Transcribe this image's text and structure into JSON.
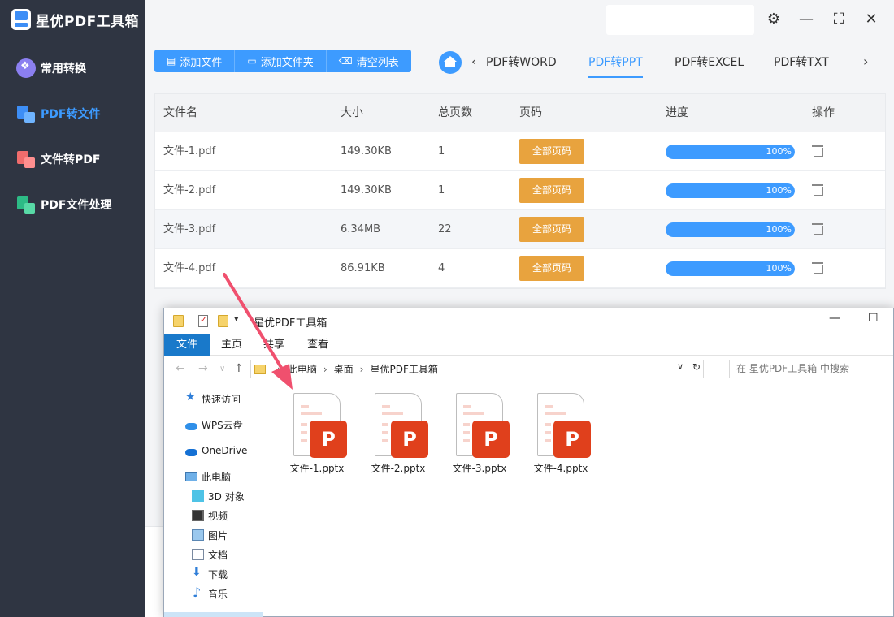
{
  "app": {
    "title": "星优PDF工具箱"
  },
  "sidebar": {
    "items": [
      {
        "label": "常用转换",
        "icon": "apps-icon",
        "active": false
      },
      {
        "label": "PDF转文件",
        "icon": "pdf-to-file-icon",
        "active": true
      },
      {
        "label": "文件转PDF",
        "icon": "file-to-pdf-icon",
        "active": false
      },
      {
        "label": "PDF文件处理",
        "icon": "pdf-process-icon",
        "active": false
      }
    ]
  },
  "window_controls": {
    "settings": "⚙",
    "minimize": "—",
    "maximize": "⛶",
    "close": "✕"
  },
  "toolbar": {
    "add_file": "添加文件",
    "add_folder": "添加文件夹",
    "clear_list": "清空列表"
  },
  "tabs": {
    "items": [
      "PDF转WORD",
      "PDF转PPT",
      "PDF转EXCEL",
      "PDF转TXT"
    ],
    "active_index": 1
  },
  "table": {
    "headers": {
      "name": "文件名",
      "size": "大小",
      "pages": "总页数",
      "range": "页码",
      "progress": "进度",
      "action": "操作"
    },
    "rows": [
      {
        "name": "文件-1.pdf",
        "size": "149.30KB",
        "pages": "1",
        "range": "全部页码",
        "progress": 100,
        "progress_label": "100%"
      },
      {
        "name": "文件-2.pdf",
        "size": "149.30KB",
        "pages": "1",
        "range": "全部页码",
        "progress": 100,
        "progress_label": "100%"
      },
      {
        "name": "文件-3.pdf",
        "size": "6.34MB",
        "pages": "22",
        "range": "全部页码",
        "progress": 100,
        "progress_label": "100%"
      },
      {
        "name": "文件-4.pdf",
        "size": "86.91KB",
        "pages": "4",
        "range": "全部页码",
        "progress": 100,
        "progress_label": "100%"
      }
    ]
  },
  "explorer": {
    "title": "星优PDF工具箱",
    "ribbon_tabs": [
      "文件",
      "主页",
      "共享",
      "查看"
    ],
    "breadcrumb": [
      "此电脑",
      "桌面",
      "星优PDF工具箱"
    ],
    "search_placeholder": "在 星优PDF工具箱 中搜索",
    "nav_items": [
      "快速访问",
      "WPS云盘",
      "OneDrive",
      "此电脑",
      "3D 对象",
      "视频",
      "图片",
      "文档",
      "下载",
      "音乐"
    ],
    "files": [
      {
        "name": "文件-1.pptx",
        "badge": "P"
      },
      {
        "name": "文件-2.pptx",
        "badge": "P"
      },
      {
        "name": "文件-3.pptx",
        "badge": "P"
      },
      {
        "name": "文件-4.pptx",
        "badge": "P"
      }
    ]
  },
  "colors": {
    "accent": "#3d9bff",
    "sidebar": "#2f3542",
    "range_button": "#e8a33e",
    "ppt_badge": "#e0401c",
    "arrow": "#f0506e"
  }
}
